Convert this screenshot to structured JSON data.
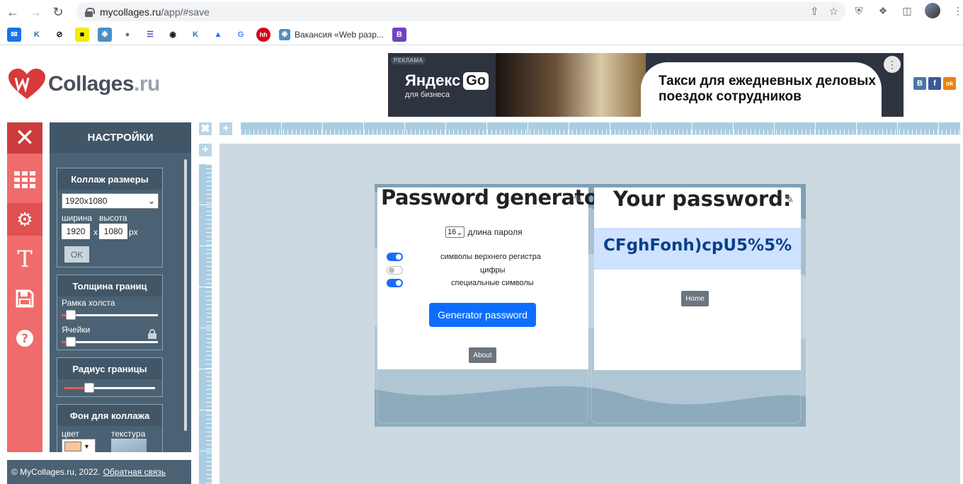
{
  "browser": {
    "url_host": "mycollages.ru",
    "url_path": "/app/#save",
    "bookmark_text": "Вакансия «Web разр..."
  },
  "site": {
    "logo_main": "Collages",
    "logo_suffix": ".ru"
  },
  "ad": {
    "label": "РЕКЛАМА",
    "brand": "Яндекс",
    "brand_badge": "Go",
    "sub": "для бизнеса",
    "headline": "Такси для ежедневных деловых поездок сотрудников"
  },
  "social": [
    "В",
    "f",
    "ok"
  ],
  "sidebar": {
    "panel_title": "НАСТРОЙКИ",
    "collage_size": {
      "title": "Коллаж размеры",
      "select_value": "1920x1080",
      "width_label": "ширина",
      "height_label": "высота",
      "width_value": "1920",
      "height_value": "1080",
      "separator": "x",
      "unit": "px",
      "ok_label": "OK"
    },
    "border_width": {
      "title": "Толщина границ",
      "frame_label": "Рамка холста",
      "cells_label": "Ячейки"
    },
    "border_radius": {
      "title": "Радиус границы"
    },
    "background": {
      "title": "Фон для коллажа",
      "color_label": "цвет",
      "texture_label": "текстура"
    }
  },
  "footer": {
    "copyright": "© MyCollages.ru, 2022.",
    "feedback": "Обратная связь"
  },
  "collage": {
    "left_title": "Password generator",
    "length_value": "16",
    "length_label": "длина пароля",
    "toggles": [
      {
        "label": "символы верхнего регистра",
        "on": true
      },
      {
        "label": "цифры",
        "on": false
      },
      {
        "label": "специальные символы",
        "on": true
      }
    ],
    "generate_label": "Generator password",
    "about_label": "About",
    "right_title": "Your password:",
    "password": "CFghFonh)cpU5%5%",
    "home_label": "Home"
  },
  "colors": {
    "sidebar_red": "#f06b6b",
    "panel_bg": "#4a6273",
    "canvas_bg": "#cdd9e1",
    "primary": "#0d6efd"
  }
}
